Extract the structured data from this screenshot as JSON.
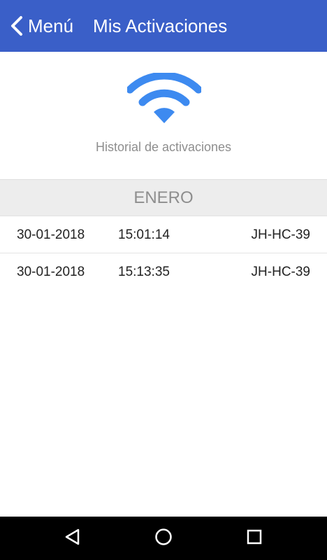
{
  "header": {
    "back_label": "Menú",
    "title": "Mis Activaciones",
    "color": "#3A5FC8"
  },
  "hero": {
    "icon": "wifi-icon",
    "icon_color": "#3D8AF0",
    "caption": "Historial de activaciones"
  },
  "month": {
    "label": "ENERO"
  },
  "activations": [
    {
      "date": "30-01-2018",
      "time": "15:01:14",
      "code": "JH-HC-39"
    },
    {
      "date": "30-01-2018",
      "time": "15:13:35",
      "code": "JH-HC-39"
    }
  ],
  "navbar": {
    "back_icon": "nav-back-icon",
    "home_icon": "nav-home-icon",
    "recent_icon": "nav-recent-icon"
  }
}
